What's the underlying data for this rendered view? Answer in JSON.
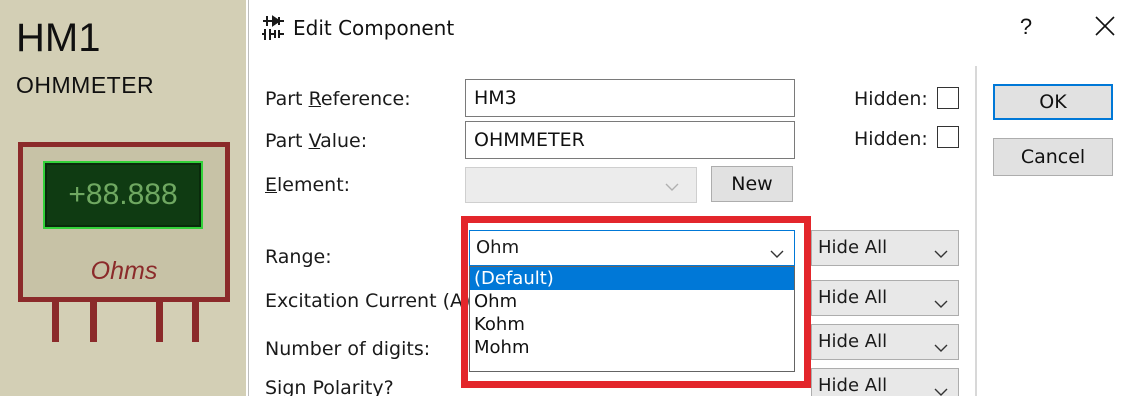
{
  "schematic": {
    "designator": "HM1",
    "type": "OHMMETER",
    "display": "+88.888",
    "unit": "Ohms"
  },
  "dialog": {
    "title": "Edit Component",
    "help": "?",
    "close_icon": "close-icon",
    "part_reference": {
      "label": "Part Reference:",
      "value": "HM3",
      "hidden_label": "Hidden:"
    },
    "part_value": {
      "label": "Part Value:",
      "value": "OHMMETER",
      "hidden_label": "Hidden:"
    },
    "element": {
      "label": "Element:",
      "value": "",
      "new_button": "New"
    },
    "range": {
      "label": "Range:",
      "value": "Ohm",
      "options": [
        "(Default)",
        "Ohm",
        "Kohm",
        "Mohm"
      ],
      "highlighted": "(Default)",
      "visibility": "Hide All"
    },
    "excitation_current": {
      "label": "Excitation Current (A)",
      "visibility": "Hide All"
    },
    "number_of_digits": {
      "label": "Number of digits:",
      "visibility": "Hide All"
    },
    "sign_polarity": {
      "label": "Sign Polarity?",
      "visibility": "Hide All"
    },
    "ok_button": "OK",
    "cancel_button": "Cancel"
  },
  "colors": {
    "highlight_box": "#e3262b",
    "selection": "#0078d7",
    "meter_border": "#8b2a2a",
    "display_bg": "#0f3b12"
  }
}
